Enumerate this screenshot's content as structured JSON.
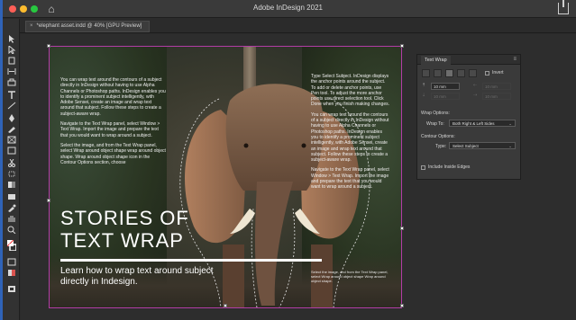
{
  "window": {
    "title": "Adobe InDesign 2021"
  },
  "document_tab": {
    "close": "×",
    "label": "*elephant asset.indd @ 40% [GPU Preview]"
  },
  "page": {
    "left_column": [
      "You can wrap text around the contours of a subject directly in InDesign without having to use Alpha Channels or Photoshop paths. InDesign enables you to identify a prominent subject intelligently, with Adobe Sensei, create an image and wrap text around that subject. Follow these steps to create a subject-aware wrap.",
      "Navigate to the Text Wrap panel, select Window > Text Wrap. Import the image and prepare the text that you would want to wrap around a subject.",
      "Select the image, and from the Text Wrap panel, select Wrap around object shape wrap around object shape. Wrap around object shape icon in the Contour Options section, choose"
    ],
    "right_column": [
      "Type Select Subject. InDesign displays the anchor points around the subject. To add or delete anchor points, use Pen tool. To adjust the more anchor points use direct selection tool. Click Done when you finish making changes.",
      "You can wrap text around the contours of a subject directly in InDesign without having to use Alpha Channels or Photoshop paths. InDesign enables you to identify a prominent subject intelligently, with Adobe Sensei, create an image and wrap text around that subject. Follow these steps to create a subject-aware wrap.",
      "Navigate to the Text Wrap panel, select Window > Text Wrap. Import the image and prepare the text that you would want to wrap around a subject."
    ],
    "footer_text": "Select the image, and from the Text Wrap panel, select Wrap around object shape Wrap around object shape.",
    "headline_line1": "STORIES OF",
    "headline_line2": "TEXT WRAP",
    "subhead": "Learn how to wrap text around subject directly in Indesign."
  },
  "text_wrap_panel": {
    "tab_label": "Text Wrap",
    "menu": "≡",
    "invert_label": "Invert",
    "top_offset": "10 mm",
    "bottom_offset": "10 mm",
    "left_offset": "10 mm",
    "right_offset": "10 mm",
    "wrap_options_label": "Wrap Options:",
    "wrap_to_label": "Wrap To:",
    "wrap_to_value": "Both Right & Left Sides",
    "contour_options_label": "Contour Options:",
    "type_label": "Type:",
    "type_value": "Select Subject",
    "include_inside_edges_label": "Include Inside Edges",
    "caret": "⌄"
  },
  "colors": {
    "accent": "#2f63b8",
    "frame": "#b23ca6"
  }
}
